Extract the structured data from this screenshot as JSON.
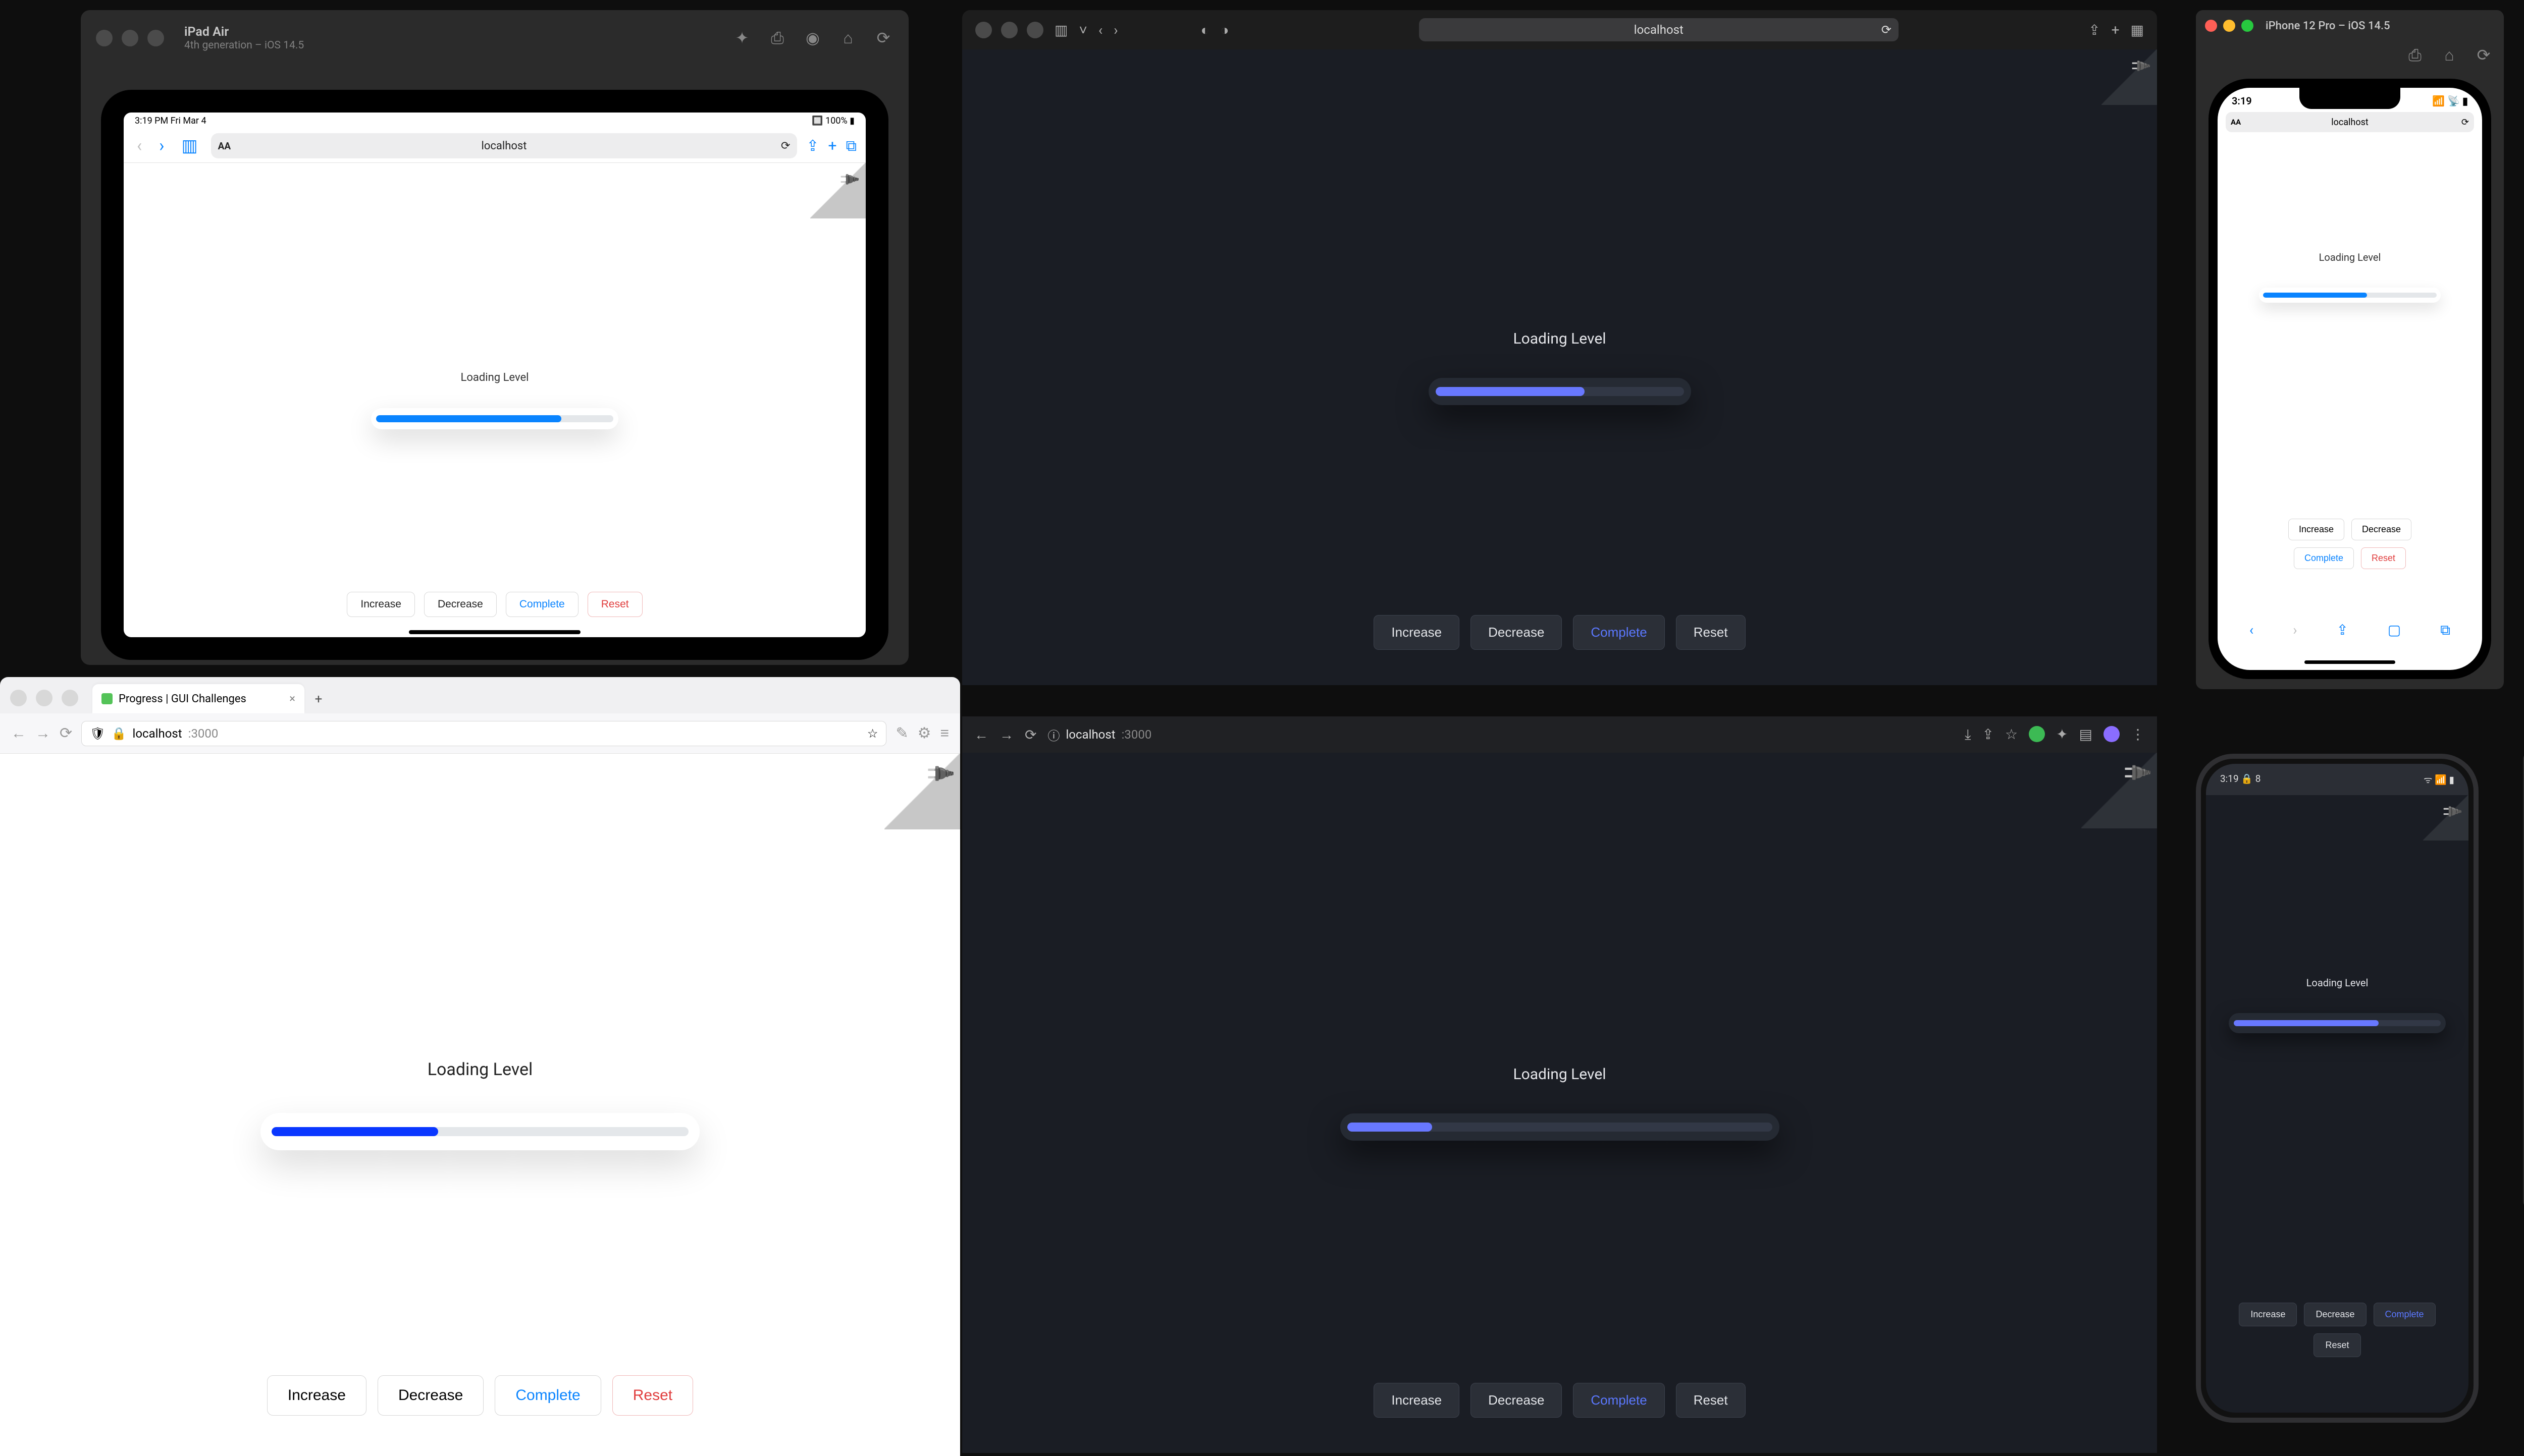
{
  "simulators": {
    "ipad": {
      "title": "iPad Air",
      "subtitle": "4th generation – iOS 14.5",
      "status_time": "3:19 PM  Fri Mar 4",
      "status_right": "🔲 100% ▮",
      "url": "localhost"
    },
    "iphone": {
      "title": "iPhone 12 Pro – iOS 14.5",
      "status_time": "3:19",
      "url": "localhost"
    },
    "android": {
      "status_left": "3:19  🔒  8",
      "status_right": "ᯤ 📶 ▮"
    }
  },
  "browsers": {
    "safari_dark": {
      "url": "localhost"
    },
    "firefox": {
      "tab_title": "Progress | GUI Challenges",
      "host": "localhost",
      "port": ":3000"
    },
    "chrome_dark": {
      "host": "localhost",
      "port": ":3000"
    }
  },
  "demo": {
    "heading": "Loading Level",
    "buttons": {
      "increase": "Increase",
      "decrease": "Decrease",
      "complete": "Complete",
      "reset": "Reset"
    },
    "progress": {
      "ipad_pct": 78,
      "safari_dark_pct": 60,
      "iphone_pct": 60,
      "firefox_pct": 40,
      "chrome_dark_pct": 20,
      "android_pct": 70
    }
  },
  "colors": {
    "blue_light": "#0a84ff",
    "blue_dark": "#6878ff",
    "red": "#e03d3d",
    "dark_bg": "#1a1d24",
    "track_light": "#e4e7ea",
    "track_dark": "#323846"
  },
  "emulator_controls": [
    "power",
    "vol-up",
    "vol-down",
    "rotate-left",
    "rotate-right",
    "camera",
    "zoom",
    "back",
    "home",
    "recents",
    "more"
  ]
}
